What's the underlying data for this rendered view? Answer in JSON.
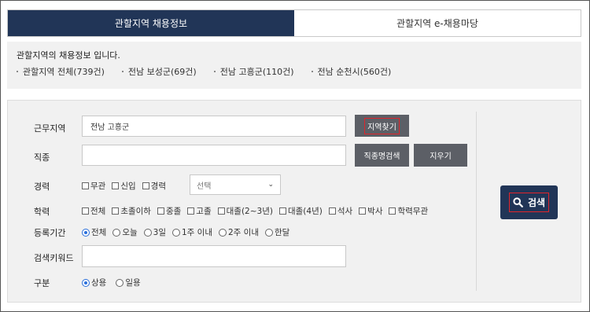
{
  "tabs": [
    {
      "label": "관할지역 채용정보",
      "active": true
    },
    {
      "label": "관할지역 e-채용마당",
      "active": false
    }
  ],
  "info": {
    "title": "관할지역의 채용정보 입니다.",
    "regions": [
      "관할지역 전체(739건)",
      "전남 보성군(69건)",
      "전남 고흥군(110건)",
      "전남 순천시(560건)"
    ]
  },
  "form": {
    "location": {
      "label": "근무지역",
      "value": "전남 고흥군",
      "find_button": "지역찾기"
    },
    "job": {
      "label": "직종",
      "value": "",
      "search_button": "직종명검색",
      "clear_button": "지우기"
    },
    "career": {
      "label": "경력",
      "options": [
        "무관",
        "신입",
        "경력"
      ],
      "select_value": "선택"
    },
    "education": {
      "label": "학력",
      "options": [
        "전체",
        "초졸이하",
        "중졸",
        "고졸",
        "대졸(2~3년)",
        "대졸(4년)",
        "석사",
        "박사",
        "학력무관"
      ]
    },
    "period": {
      "label": "등록기간",
      "options": [
        "전체",
        "오늘",
        "3일",
        "1주 이내",
        "2주 이내",
        "한달"
      ],
      "selected": "전체"
    },
    "keyword": {
      "label": "검색키워드",
      "value": ""
    },
    "type": {
      "label": "구분",
      "options": [
        "상용",
        "일용"
      ],
      "selected": "상용"
    },
    "search_button": "검색"
  },
  "colors": {
    "primary": "#213557",
    "highlight": "#e0252b",
    "button_gray": "#5c5f66"
  }
}
